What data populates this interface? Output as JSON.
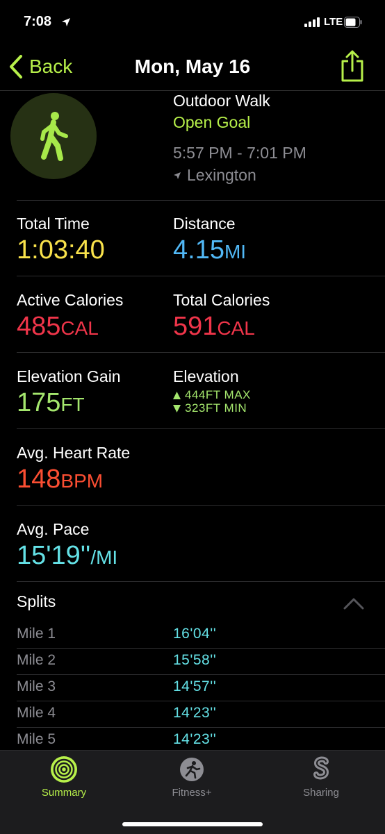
{
  "status_bar": {
    "time": "7:08",
    "network": "LTE"
  },
  "nav": {
    "back_label": "Back",
    "title": "Mon, May 16"
  },
  "workout": {
    "type": "Outdoor Walk",
    "goal": "Open Goal",
    "time_range": "5:57 PM - 7:01 PM",
    "location": "Lexington"
  },
  "metrics": {
    "total_time": {
      "label": "Total Time",
      "value": "1:03:40"
    },
    "distance": {
      "label": "Distance",
      "value": "4.15",
      "unit": "MI"
    },
    "active_calories": {
      "label": "Active Calories",
      "value": "485",
      "unit": "CAL"
    },
    "total_calories": {
      "label": "Total Calories",
      "value": "591",
      "unit": "CAL"
    },
    "elevation_gain": {
      "label": "Elevation Gain",
      "value": "175",
      "unit": "FT"
    },
    "elevation": {
      "label": "Elevation",
      "max": "444FT MAX",
      "min": "323FT MIN"
    },
    "avg_heart_rate": {
      "label": "Avg. Heart Rate",
      "value": "148",
      "unit": "BPM"
    },
    "avg_pace": {
      "label": "Avg. Pace",
      "value": "15'19''",
      "unit": "/MI"
    }
  },
  "splits": {
    "title": "Splits",
    "rows": [
      {
        "mile": "Mile 1",
        "pace": "16'04''"
      },
      {
        "mile": "Mile 2",
        "pace": "15'58''"
      },
      {
        "mile": "Mile 3",
        "pace": "14'57''"
      },
      {
        "mile": "Mile 4",
        "pace": "14'23''"
      },
      {
        "mile": "Mile 5",
        "pace": "14'23''"
      }
    ]
  },
  "tabs": [
    {
      "label": "Summary",
      "icon": "summary-rings-icon",
      "active": true
    },
    {
      "label": "Fitness+",
      "icon": "fitness-plus-runner-icon",
      "active": false
    },
    {
      "label": "Sharing",
      "icon": "sharing-icon",
      "active": false
    }
  ],
  "colors": {
    "accent": "#b7f04a",
    "total_time": "#f9e24b",
    "distance": "#51b8f6",
    "calories": "#f0354a",
    "elevation": "#a4e66d",
    "heart_rate": "#fb4e32",
    "pace": "#64e1e6"
  }
}
